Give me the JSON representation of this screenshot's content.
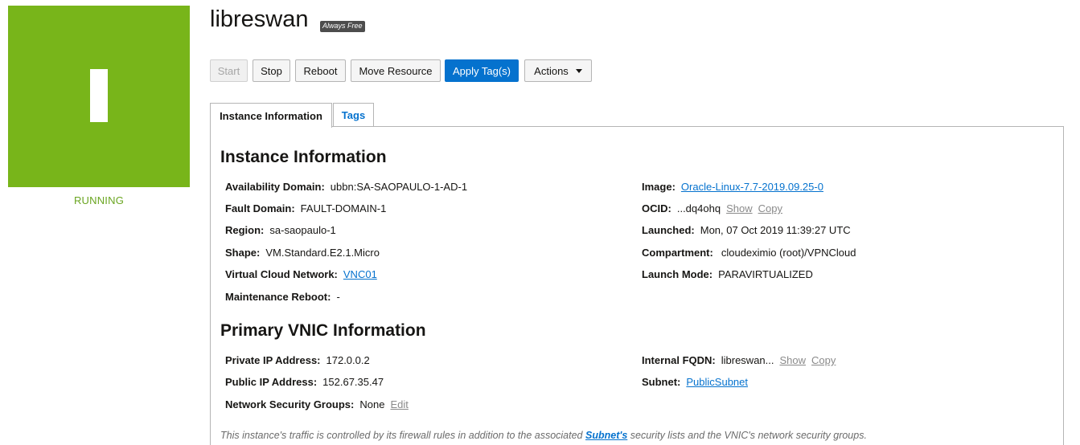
{
  "instance": {
    "name": "libreswan",
    "badge": "Always Free",
    "status": "RUNNING",
    "status_letter": "I",
    "status_color": "#78b51a"
  },
  "toolbar": {
    "start": "Start",
    "stop": "Stop",
    "reboot": "Reboot",
    "move": "Move Resource",
    "apply_tags": "Apply Tag(s)",
    "actions": "Actions"
  },
  "tabs": {
    "instance_info": "Instance Information",
    "tags": "Tags"
  },
  "info": {
    "heading": "Instance Information",
    "availability_domain": {
      "label": "Availability Domain:",
      "value": "ubbn:SA-SAOPAULO-1-AD-1"
    },
    "fault_domain": {
      "label": "Fault Domain:",
      "value": "FAULT-DOMAIN-1"
    },
    "region": {
      "label": "Region:",
      "value": "sa-saopaulo-1"
    },
    "shape": {
      "label": "Shape:",
      "value": "VM.Standard.E2.1.Micro"
    },
    "vcn": {
      "label": "Virtual Cloud Network:",
      "value": "VNC01"
    },
    "maintenance_reboot": {
      "label": "Maintenance Reboot:",
      "value": "-"
    },
    "image": {
      "label": "Image:",
      "value": "Oracle-Linux-7.7-2019.09.25-0"
    },
    "ocid": {
      "label": "OCID:",
      "value": "...dq4ohq",
      "show": "Show",
      "copy": "Copy"
    },
    "launched": {
      "label": "Launched:",
      "value": "Mon, 07 Oct 2019 11:39:27 UTC"
    },
    "compartment": {
      "label": "Compartment:",
      "value": "cloudeximio (root)/VPNCloud"
    },
    "launch_mode": {
      "label": "Launch Mode:",
      "value": "PARAVIRTUALIZED"
    }
  },
  "vnic": {
    "heading": "Primary VNIC Information",
    "private_ip": {
      "label": "Private IP Address:",
      "value": "172.0.0.2"
    },
    "public_ip": {
      "label": "Public IP Address:",
      "value": "152.67.35.47"
    },
    "nsg": {
      "label": "Network Security Groups:",
      "value": "None",
      "edit": "Edit"
    },
    "fqdn": {
      "label": "Internal FQDN:",
      "value": "libreswan...",
      "show": "Show",
      "copy": "Copy"
    },
    "subnet": {
      "label": "Subnet:",
      "value": "PublicSubnet"
    }
  },
  "footnote": {
    "before": "This instance's traffic is controlled by its firewall rules in addition to the associated ",
    "link": "Subnet's",
    "after": " security lists and the VNIC's network security groups."
  }
}
